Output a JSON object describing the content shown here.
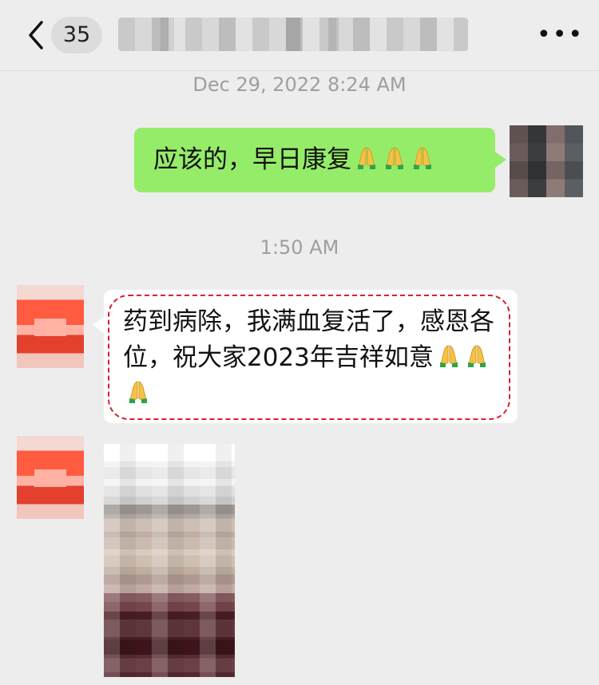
{
  "header": {
    "unread_count": "35",
    "more_label": "•••"
  },
  "timestamps": [
    "Dec 29, 2022 8:24 AM",
    "1:50 AM"
  ],
  "messages": [
    {
      "direction": "outgoing",
      "text": "应该的，早日康复",
      "emoji_icons": [
        "folded-hands-icon",
        "folded-hands-icon",
        "folded-hands-icon"
      ]
    },
    {
      "direction": "incoming",
      "text": "药到病除，我满血复活了，感恩各位，祝大家2023年吉祥如意",
      "emoji_icons": [
        "folded-hands-icon",
        "folded-hands-icon",
        "folded-hands-icon"
      ],
      "highlighted": true
    },
    {
      "direction": "incoming",
      "type": "image",
      "blurred": true
    }
  ],
  "colors": {
    "background": "#ededed",
    "outgoing_bubble": "#95ec69",
    "incoming_bubble": "#ffffff",
    "highlight_border": "#d81e2f",
    "timestamp_text": "#9e9e9e"
  }
}
